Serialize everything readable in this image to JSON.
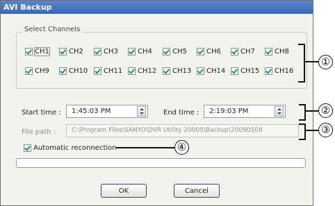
{
  "window": {
    "title": "AVI Backup"
  },
  "channels": {
    "group_label": "Select Channels",
    "items": [
      {
        "label": "CH1",
        "checked": true
      },
      {
        "label": "CH2",
        "checked": true
      },
      {
        "label": "CH3",
        "checked": true
      },
      {
        "label": "CH4",
        "checked": true
      },
      {
        "label": "CH5",
        "checked": true
      },
      {
        "label": "CH6",
        "checked": true
      },
      {
        "label": "CH7",
        "checked": true
      },
      {
        "label": "CH8",
        "checked": true
      },
      {
        "label": "CH9",
        "checked": true
      },
      {
        "label": "CH10",
        "checked": true
      },
      {
        "label": "CH11",
        "checked": true
      },
      {
        "label": "CH12",
        "checked": true
      },
      {
        "label": "CH13",
        "checked": true
      },
      {
        "label": "CH14",
        "checked": true
      },
      {
        "label": "CH15",
        "checked": true
      },
      {
        "label": "CH16",
        "checked": true
      }
    ]
  },
  "time": {
    "start_label": "Start time :",
    "start_value": "1:45:03 PM",
    "end_label": "End time :",
    "end_value": "2:19:03 PM"
  },
  "file": {
    "label": "File path :",
    "value": "C:\\Program Files\\SANYO\\DVR Utility 2000S\\Backup\\20090508"
  },
  "auto_reconnect": {
    "label": "Automatic reconnection",
    "checked": true
  },
  "progress": {
    "value": 0
  },
  "buttons": {
    "ok": "OK",
    "cancel": "Cancel"
  },
  "callouts": {
    "c1": "①",
    "c2": "②",
    "c3": "③",
    "c4": "④"
  }
}
